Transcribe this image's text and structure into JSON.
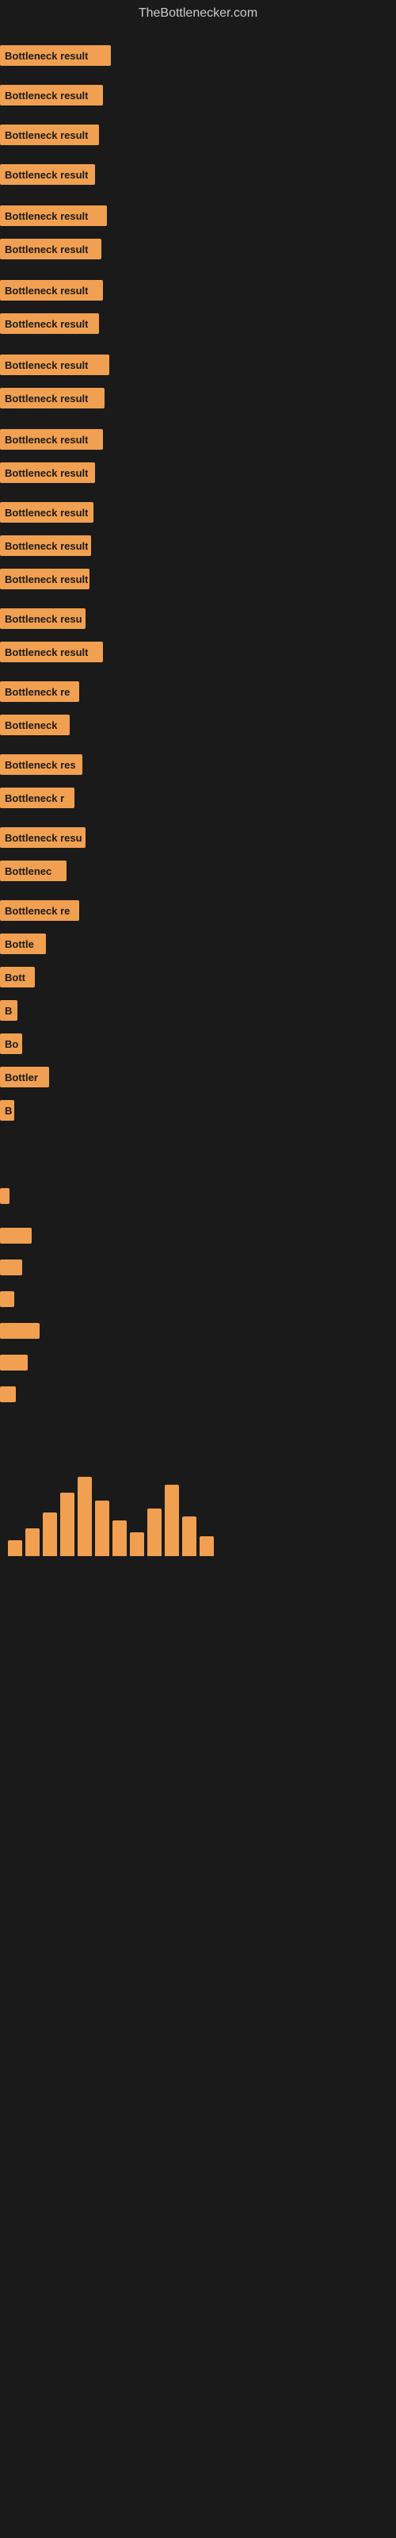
{
  "site": {
    "title": "TheBottlenecker.com"
  },
  "bars": [
    {
      "label": "Bottleneck result",
      "width": 140,
      "marginTop": 10
    },
    {
      "label": "Bottleneck result",
      "width": 130,
      "marginTop": 18
    },
    {
      "label": "Bottleneck result",
      "width": 125,
      "marginTop": 18
    },
    {
      "label": "Bottleneck result",
      "width": 120,
      "marginTop": 18
    },
    {
      "label": "Bottleneck result",
      "width": 135,
      "marginTop": 20
    },
    {
      "label": "Bottleneck result",
      "width": 128,
      "marginTop": 10
    },
    {
      "label": "Bottleneck result",
      "width": 130,
      "marginTop": 20
    },
    {
      "label": "Bottleneck result",
      "width": 125,
      "marginTop": 10
    },
    {
      "label": "Bottleneck result",
      "width": 138,
      "marginTop": 20
    },
    {
      "label": "Bottleneck result",
      "width": 132,
      "marginTop": 10
    },
    {
      "label": "Bottleneck result",
      "width": 130,
      "marginTop": 20
    },
    {
      "label": "Bottleneck result",
      "width": 120,
      "marginTop": 10
    },
    {
      "label": "Bottleneck result",
      "width": 118,
      "marginTop": 18
    },
    {
      "label": "Bottleneck result",
      "width": 115,
      "marginTop": 10
    },
    {
      "label": "Bottleneck result",
      "width": 113,
      "marginTop": 10
    },
    {
      "label": "Bottleneck resu",
      "width": 108,
      "marginTop": 18
    },
    {
      "label": "Bottleneck result",
      "width": 130,
      "marginTop": 10
    },
    {
      "label": "Bottleneck re",
      "width": 100,
      "marginTop": 18
    },
    {
      "label": "Bottleneck",
      "width": 88,
      "marginTop": 10
    },
    {
      "label": "Bottleneck res",
      "width": 104,
      "marginTop": 18
    },
    {
      "label": "Bottleneck r",
      "width": 94,
      "marginTop": 10
    },
    {
      "label": "Bottleneck resu",
      "width": 108,
      "marginTop": 18
    },
    {
      "label": "Bottlenec",
      "width": 84,
      "marginTop": 10
    },
    {
      "label": "Bottleneck re",
      "width": 100,
      "marginTop": 18
    },
    {
      "label": "Bottle",
      "width": 58,
      "marginTop": 10
    },
    {
      "label": "Bott",
      "width": 44,
      "marginTop": 10
    },
    {
      "label": "B",
      "width": 22,
      "marginTop": 10
    },
    {
      "label": "Bo",
      "width": 28,
      "marginTop": 10
    },
    {
      "label": "Bottler",
      "width": 62,
      "marginTop": 10
    },
    {
      "label": "B",
      "width": 18,
      "marginTop": 10
    }
  ],
  "smallBars": [
    {
      "width": 12,
      "marginTop": 60
    },
    {
      "width": 40,
      "marginTop": 30
    },
    {
      "width": 28,
      "marginTop": 20
    },
    {
      "width": 18,
      "marginTop": 20
    },
    {
      "width": 50,
      "marginTop": 20
    },
    {
      "width": 35,
      "marginTop": 20
    },
    {
      "width": 20,
      "marginTop": 20
    }
  ],
  "verticalBars": [
    {
      "height": 20
    },
    {
      "height": 35
    },
    {
      "height": 55
    },
    {
      "height": 80
    },
    {
      "height": 100
    },
    {
      "height": 70
    },
    {
      "height": 45
    },
    {
      "height": 30
    },
    {
      "height": 60
    },
    {
      "height": 90
    },
    {
      "height": 50
    },
    {
      "height": 25
    }
  ]
}
